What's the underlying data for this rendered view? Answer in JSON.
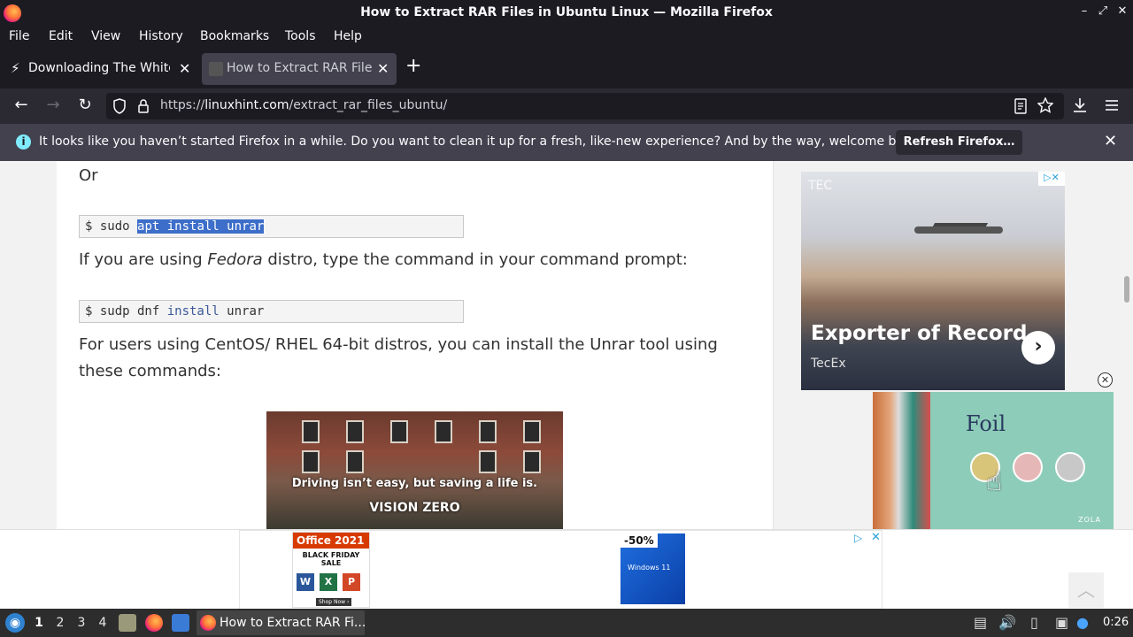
{
  "window": {
    "title": "How to Extract RAR Files in Ubuntu Linux — Mozilla Firefox",
    "controls": {
      "minimize": "–",
      "maximize": "⤢",
      "close": "✕"
    }
  },
  "menu": [
    "File",
    "Edit",
    "View",
    "History",
    "Bookmarks",
    "Tools",
    "Help"
  ],
  "tabs": [
    {
      "label": "Downloading The White H",
      "close": "✕",
      "active": false
    },
    {
      "label": "How to Extract RAR Files",
      "close": "✕",
      "active": true
    }
  ],
  "new_tab": "+",
  "navbar": {
    "back": "←",
    "forward": "→",
    "reload": "↻",
    "url_prefix": "https://",
    "url_domain": "linuxhint.com",
    "url_path": "/extract_rar_files_ubuntu/"
  },
  "notification": {
    "message": "It looks like you haven’t started Firefox in a while. Do you want to clean it up for a fresh, like-new experience? And by the way, welcome back!",
    "button": "Refresh Firefox…",
    "close": "✕"
  },
  "article": {
    "or_text": "Or",
    "code1": {
      "prompt": "$ sudo ",
      "selected": "apt install unrar"
    },
    "fedora_pre": "If you are using ",
    "fedora_em": "Fedora",
    "fedora_post": " distro, type the command in your command prompt:",
    "code2": {
      "prompt": "$ sudp dnf ",
      "kw": "install",
      "rest": " unrar"
    },
    "centos_line1": "For users using CentOS/ RHEL 64-bit distros, you can install the Unrar tool using",
    "centos_line2": "these commands:",
    "video_caption": "Driving isn’t easy, but saving a life is.",
    "video_brand": "VISION ZERO"
  },
  "ads": {
    "tecex": {
      "headline": "Exporter of Record",
      "sub": "TecEx",
      "logo": "TEC",
      "arrow": "›"
    },
    "zola": {
      "title": "Foil",
      "brand": "ZOLA",
      "dots": [
        "#d8c57a",
        "#e6b7b7",
        "#c8c8c8"
      ]
    },
    "bottom": {
      "office_title": "Office 2021",
      "office_sale": "BLACK FRIDAY SALE",
      "office_shop": "Shop Now ›",
      "office_apps": [
        "W",
        "X",
        "P"
      ],
      "win_badge": "-50%",
      "win_logo": "Windows 11"
    }
  },
  "taskbar": {
    "workspaces": [
      "1",
      "2",
      "3",
      "4"
    ],
    "task_label": "How to Extract RAR Fi...",
    "clock": "0:26"
  }
}
